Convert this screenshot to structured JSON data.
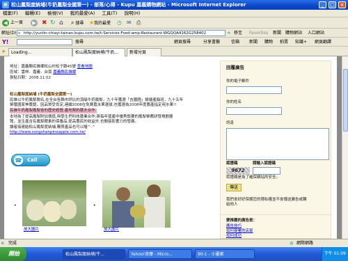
{
  "window": {
    "title": "松山鳳梨度納埔(牛奶鳳梨全國第一) - 部落/心得 - Kupu 嘉義購物網站 - Microsoft Internet Explorer"
  },
  "menubar": {
    "items": [
      "檔案(F)",
      "編輯(E)",
      "檢視(V)",
      "我的最愛(A)",
      "工具(T)",
      "說明(H)"
    ]
  },
  "toolbar": {
    "back": "上一頁",
    "search": "搜尋",
    "favorites": "我的最愛"
  },
  "address": {
    "label": "網址(D)",
    "url": "http://yunlin-chiayi-tainan.kupu.com.tw/t-Services-Food-amp-Restaurant-WGQQA4162G258402",
    "go": "移至",
    "favorites_label": "Favorites",
    "news": "新聞",
    "shopping": "購物網站",
    "portal": "入口網站"
  },
  "yahoo": {
    "search_btn": "搜尋",
    "web_search": "網頁搜尋",
    "share": "分享書籤",
    "mail": "信箱",
    "news": "新聞",
    "shopping": "購物",
    "auction": "拍賣",
    "knowledge": "知識+",
    "more": "網頁翻譯"
  },
  "tabs": [
    {
      "label": "Loading..."
    },
    {
      "label": "松山鳳梨度納埔(牛奶..."
    },
    {
      "label": "新增分頁"
    }
  ],
  "content": {
    "address_line": "地址：嘉義縣民雄鄉松山村松子腳45號",
    "map_link": "查看地圖",
    "region_line": "區域：雲林．嘉義．台南",
    "region_link": "嘉義縣民雄鄉",
    "published": "張貼日期：2008.11.02",
    "intro_heading": "松山鳳梨度納埔 (牛奶鳳梨全國第一)",
    "para1_line1": "民雄以牛奶鳳梨聞名,在全台各縣市評比的頂級牛奶鳳梨，九十年獲選「吉園圃」績優產銷班，九十五年",
    "para1_line2": "榮獲國家神農獎，因品質受肯定,連續2008在免費嘉水果選拔,也獲選為2008年度農產指定用水果!!",
    "highlight_line": "民雄牛奶鳳梨鳳梨會的歷史經營,產地契約農夫合作.",
    "para2_line1": "本地為了提高鳳梨附加價值,與學生們科技農業合作,將每年盛產中優秀既要的鳳梨舉薦研發規劃展",
    "para2_line2": "覽，並生產含有鳳梨酵素的保養品,提高農民的收益外,也間接影響力的發展。",
    "para3_line1": "讀者接連結松山鳳梨度納埔,購買產品也可以喔^.^",
    "website_link": "http://www.songshanpineapple.com.tw/",
    "call_label": "Call me!",
    "photo1_caption": "放大圖片",
    "photo2_caption": "放大圖片"
  },
  "sidebar": {
    "heading": "回覆廣告",
    "email_label": "你的電子郵件",
    "name_label": "你的姓名",
    "message_label": "訊息",
    "captcha_label": "認證碼",
    "captcha_hint": "請輸入認證碼",
    "captcha_value": "9672",
    "captcha_note": "認證碼是為了確保網站的安全。",
    "send_button": "傳送",
    "privacy_note_line1": "我們會好好保護您的隱私權並不會傳送廣告或轉",
    "privacy_note_line2": "給他人",
    "related_heading": "要推薦的廣告是：",
    "related_links": [
      "廣告技巧",
      "如何簽署的店家",
      "如何成功"
    ]
  },
  "status": {
    "text": "完成",
    "zone": "網際網路"
  },
  "taskbar": {
    "start": "開始",
    "tasks": [
      "松山鳳梨度納埔(牛...",
      "Yahoo!奇摩 - Micro...",
      "90-1 - 小畫家"
    ],
    "clock": "下午 01:09"
  }
}
